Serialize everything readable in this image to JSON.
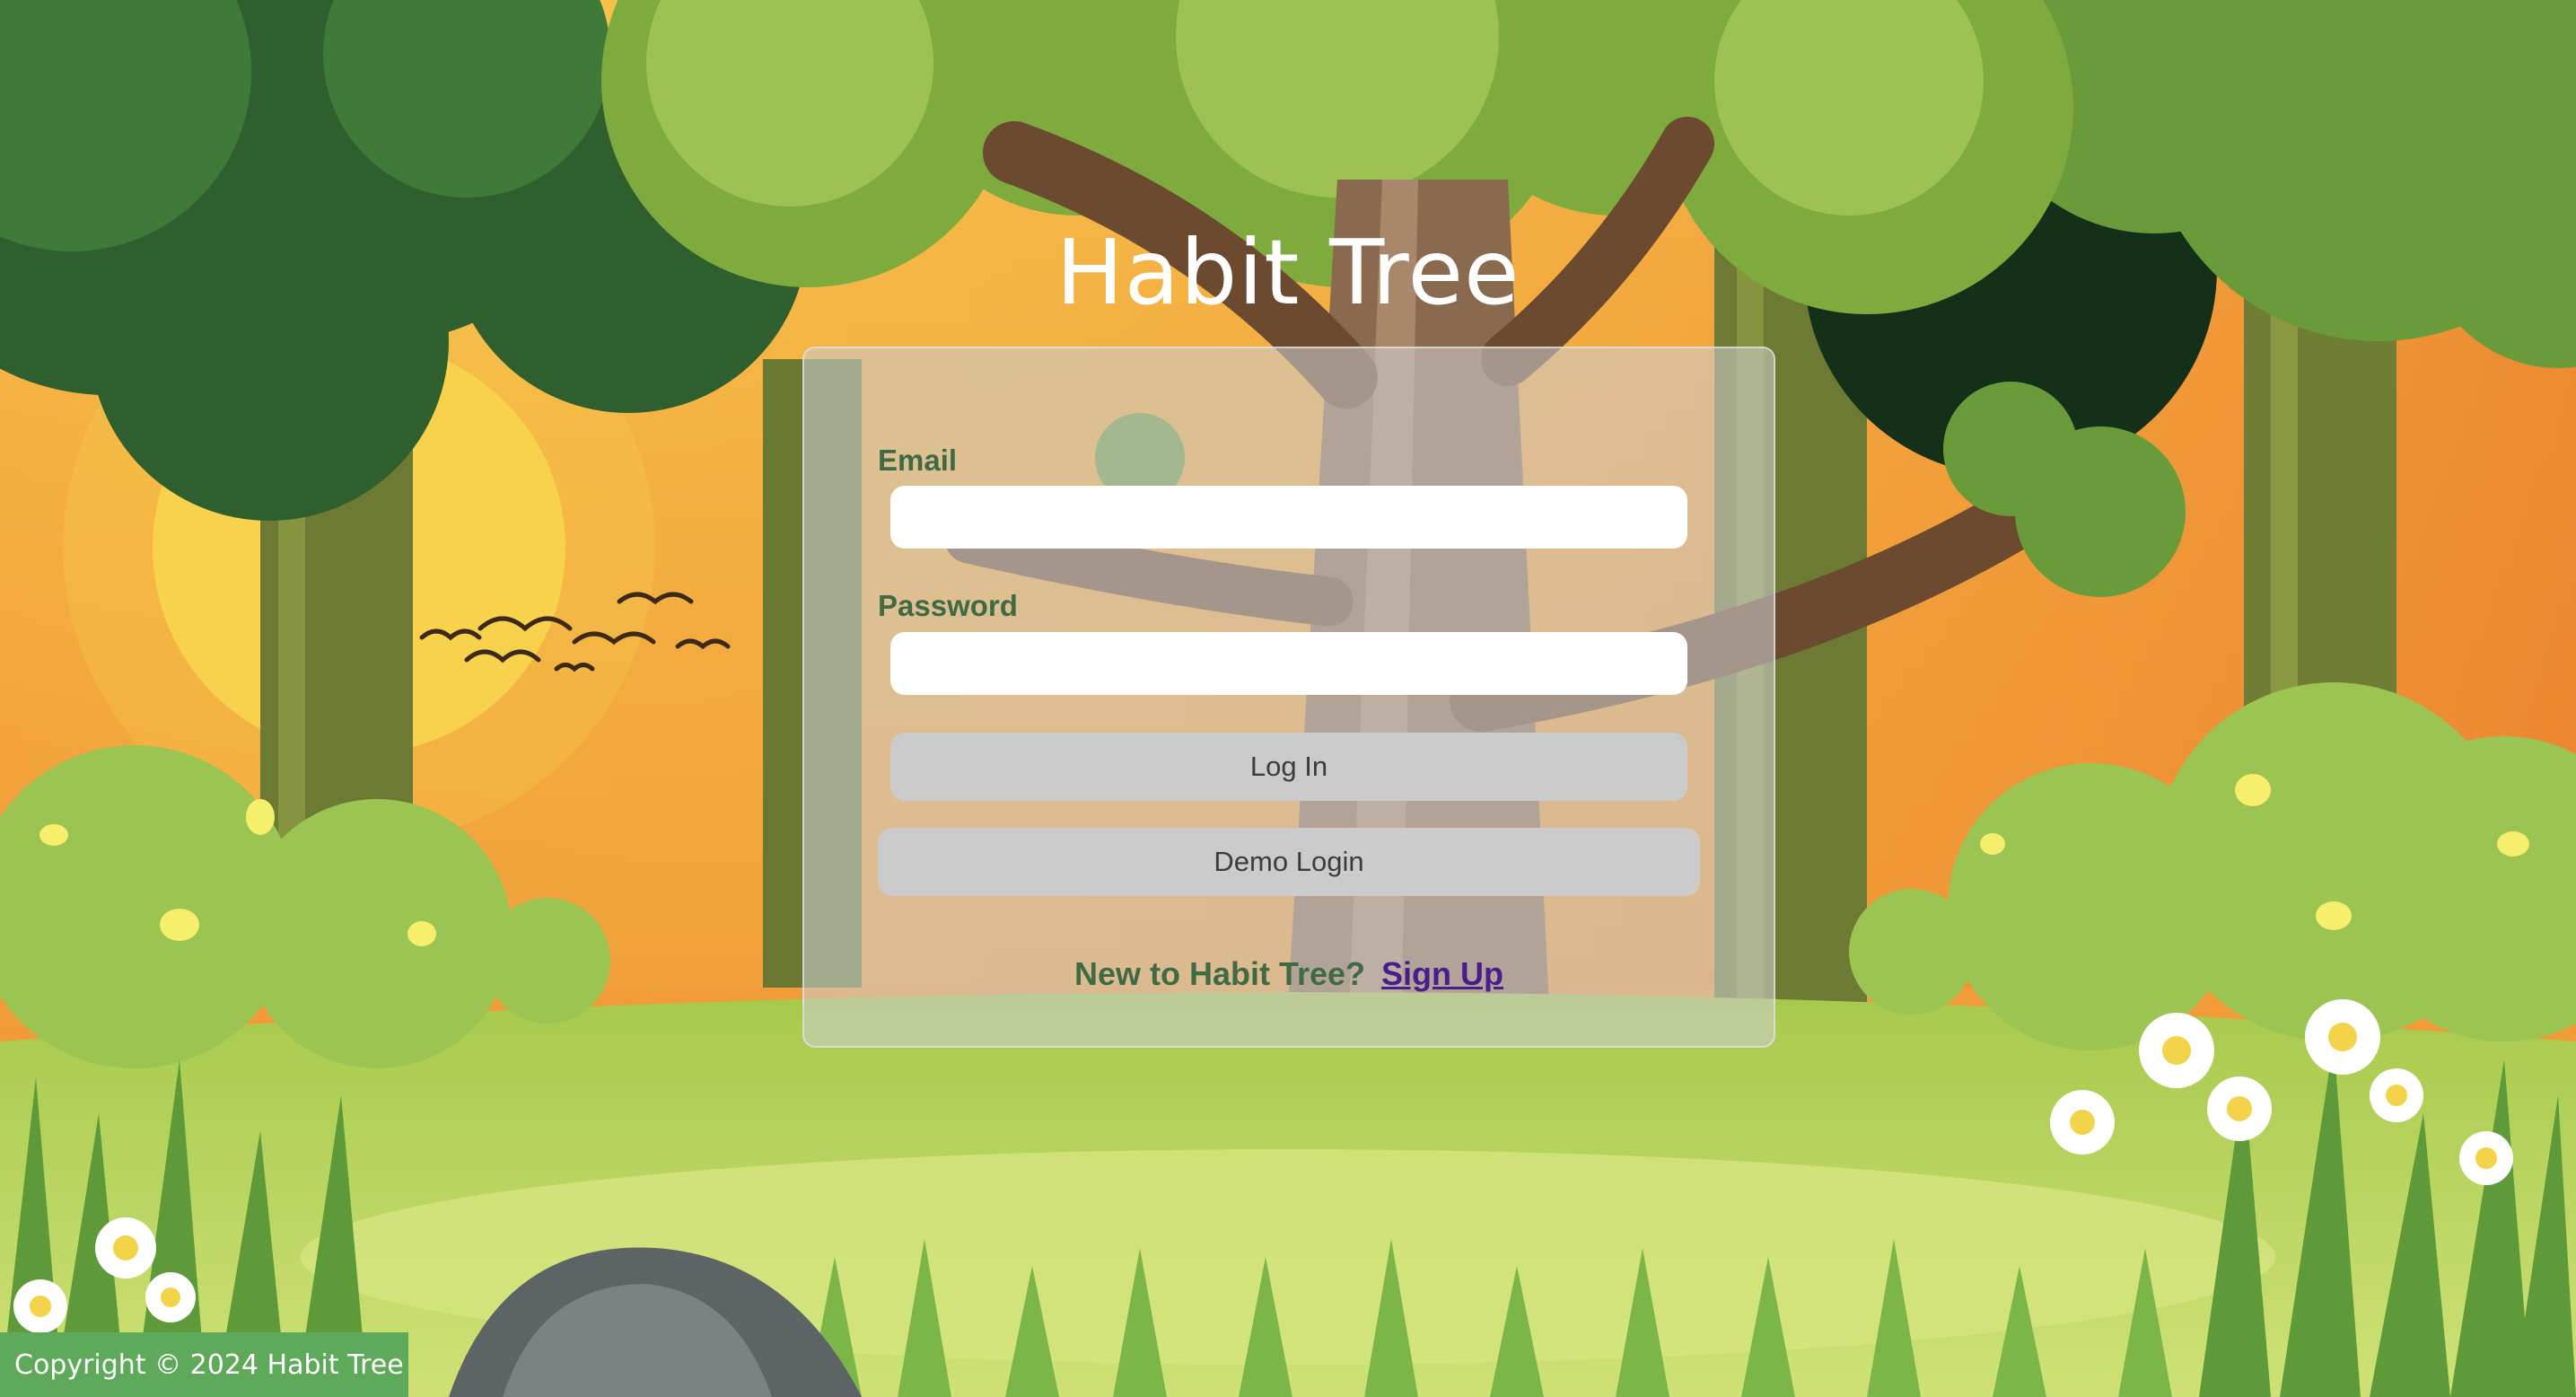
{
  "app": {
    "title": "Habit Tree"
  },
  "login": {
    "email_label": "Email",
    "email_value": "",
    "password_label": "Password",
    "password_value": "",
    "login_button": "Log In",
    "demo_button": "Demo Login",
    "signup_prompt": "New to Habit Tree?",
    "signup_link": "Sign Up"
  },
  "footer": {
    "copyright": "Copyright © 2024 Habit Tree"
  },
  "colors": {
    "sky": "#f2a23a",
    "foliage": "#8fbf4a",
    "grass": "#b9d65a",
    "label_text": "#3f6a44",
    "link": "#4a1c8c",
    "footer_bg": "#5fa95a"
  }
}
